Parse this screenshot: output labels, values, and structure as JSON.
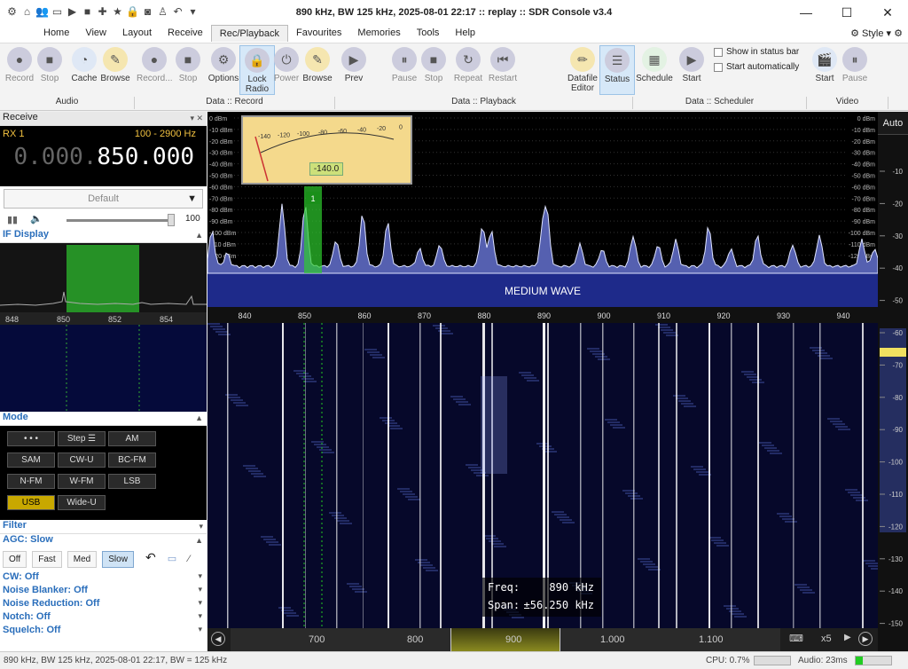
{
  "window": {
    "title": "890 kHz, BW 125 kHz, 2025-08-01 22:17 :: replay :: SDR Console v3.4",
    "quick_access_icons": [
      "home-icon",
      "users-icon",
      "folder-icon",
      "play-icon",
      "stop-icon",
      "plus-icon",
      "star-icon",
      "lock-icon",
      "camera-icon",
      "person-icon",
      "undo-icon",
      "dropdown-icon"
    ],
    "controls": {
      "minimize": "—",
      "maximize": "☐",
      "close": "✕"
    }
  },
  "menu": {
    "tabs": [
      "Home",
      "View",
      "Layout",
      "Receive",
      "Rec/Playback",
      "Favourites",
      "Memories",
      "Tools",
      "Help"
    ],
    "active_tab": "Rec/Playback",
    "style_label": "Style"
  },
  "ribbon": {
    "buttons": [
      {
        "label": "Record",
        "icon": "record-icon"
      },
      {
        "label": "Stop",
        "icon": "stop-icon"
      },
      {
        "label": "Cache",
        "icon": "cache-icon"
      },
      {
        "label": "Browse",
        "icon": "browse-icon"
      },
      {
        "label": "Record...",
        "icon": "record-icon"
      },
      {
        "label": "Stop",
        "icon": "stop-icon"
      },
      {
        "label": "Options",
        "icon": "gear-icon"
      },
      {
        "label": "Lock Radio",
        "icon": "lock-icon"
      },
      {
        "label": "Power",
        "icon": "power-icon"
      },
      {
        "label": "Browse",
        "icon": "browse-icon"
      },
      {
        "label": "Prev",
        "icon": "play-icon"
      },
      {
        "label": "Pause",
        "icon": "pause-icon"
      },
      {
        "label": "Stop",
        "icon": "stop-icon"
      },
      {
        "label": "Repeat",
        "icon": "repeat-icon"
      },
      {
        "label": "Restart",
        "icon": "restart-icon"
      },
      {
        "label": "Datafile Editor",
        "icon": "edit-icon"
      },
      {
        "label": "Status",
        "icon": "status-icon"
      },
      {
        "label": "Schedule",
        "icon": "calendar-icon"
      },
      {
        "label": "Start",
        "icon": "play-icon"
      },
      {
        "label": "Start",
        "icon": "clapper-icon"
      },
      {
        "label": "Pause",
        "icon": "pause-icon"
      }
    ],
    "groups": [
      "Audio",
      "Data :: Record",
      "Data :: Playback",
      "Data :: Scheduler",
      "Video"
    ],
    "checkboxes": [
      "Show in status bar",
      "Start automatically"
    ]
  },
  "receive": {
    "header": "Receive",
    "rx": "RX 1",
    "bandwidth": "100 - 2900 Hz",
    "freq_dim": "0.000.",
    "freq_main": "850.000",
    "preset": "Default",
    "volume": "100"
  },
  "if_display": {
    "header": "IF Display",
    "ticks": [
      "848",
      "850",
      "852",
      "854"
    ]
  },
  "mode": {
    "header": "Mode",
    "buttons": [
      "• • •",
      "Step ☰",
      "AM",
      "SAM",
      "CW-U",
      "BC-FM",
      "N-FM",
      "W-FM",
      "LSB",
      "USB",
      "Wide-U"
    ],
    "active": "USB"
  },
  "filter": {
    "header": "Filter"
  },
  "agc": {
    "header": "AGC: Slow",
    "buttons": [
      "Off",
      "Fast",
      "Med",
      "Slow"
    ],
    "active": "Slow"
  },
  "options": [
    "CW: Off",
    "Noise Blanker: Off",
    "Noise Reduction: Off",
    "Notch: Off",
    "Squelch: Off"
  ],
  "spectrum": {
    "dbm_labels": [
      "0 dBm",
      "-10 dBm",
      "-20 dBm",
      "-30 dBm",
      "-40 dBm",
      "-50 dBm",
      "-60 dBm",
      "-70 dBm",
      "-80 dBm",
      "-90 dBm",
      "-100 dBm",
      "-110 dBm",
      "-120 dBm",
      "-130 dBm",
      "-140 dBm",
      "-150 dBm"
    ],
    "freq_ticks": [
      "840",
      "850",
      "860",
      "870",
      "880",
      "890",
      "900",
      "910",
      "920",
      "930",
      "940"
    ],
    "band_label": "MEDIUM WAVE",
    "marker": "1",
    "meter_ticks": [
      "-140",
      "-120",
      "-100",
      "-80",
      "-60",
      "-40",
      "-20",
      "0"
    ],
    "meter_value": "-140.0"
  },
  "waterfall": {
    "freq_label": "Freq:",
    "freq_value": "890 kHz",
    "span_label": "Span:",
    "span_value": "±56.250 kHz",
    "ticks": [
      "700",
      "800",
      "900",
      "1.000",
      "1.100"
    ],
    "zoom": "x5"
  },
  "right_scale": {
    "auto": "Auto",
    "labels": [
      "-10",
      "-20",
      "-30",
      "-40",
      "-50",
      "-60",
      "-70",
      "-80",
      "-90",
      "-100",
      "-110",
      "-120",
      "-130",
      "-140",
      "-150"
    ]
  },
  "status": {
    "left": "890 kHz, BW 125 kHz, 2025-08-01 22:17, BW = 125 kHz",
    "cpu": "CPU: 0.7%",
    "audio": "Audio: 23ms"
  }
}
